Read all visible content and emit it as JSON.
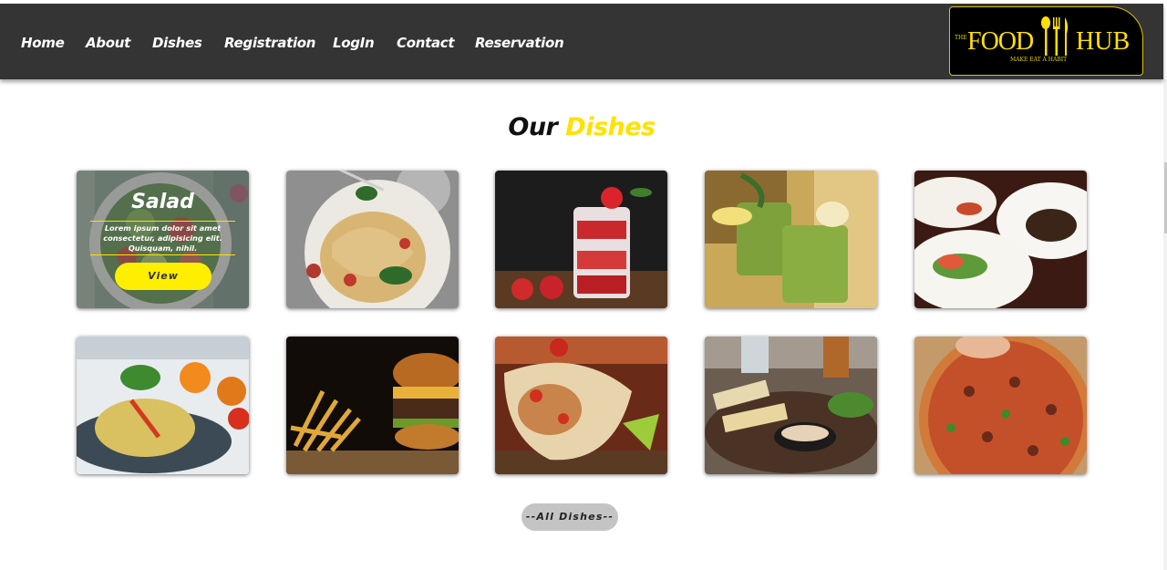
{
  "nav": {
    "items": [
      {
        "label": "Home"
      },
      {
        "label": "About"
      },
      {
        "label": "Dishes"
      },
      {
        "label": "Registration"
      },
      {
        "label": "LogIn"
      },
      {
        "label": "Contact"
      },
      {
        "label": "Reservation"
      }
    ]
  },
  "logo": {
    "prefix": "THE",
    "word1": "FOOD",
    "word2": "HUB",
    "tagline": "MAKE EAT A HABIT"
  },
  "section": {
    "title_main": "Our",
    "title_accent": "Dishes"
  },
  "dishes": [
    {
      "name": "salad",
      "overlay_title": "Salad",
      "overlay_text": "Lorem ipsum dolor sit amet consectetur, adipisicing elit. Quisquam, nihil.",
      "button": "View"
    },
    {
      "name": "spaghetti"
    },
    {
      "name": "strawberry-parfait"
    },
    {
      "name": "matcha-dessert"
    },
    {
      "name": "fine-dining-plates"
    },
    {
      "name": "noodle-plate"
    },
    {
      "name": "burger-fries"
    },
    {
      "name": "burrito-wrap"
    },
    {
      "name": "sandwich-platter"
    },
    {
      "name": "pizza"
    }
  ],
  "all_dishes_button": "--All Dishes--",
  "colors": {
    "navbar": "#343434",
    "accent": "#ffe100",
    "button_yellow": "#ffee00",
    "button_grey": "#c4c4c4"
  }
}
